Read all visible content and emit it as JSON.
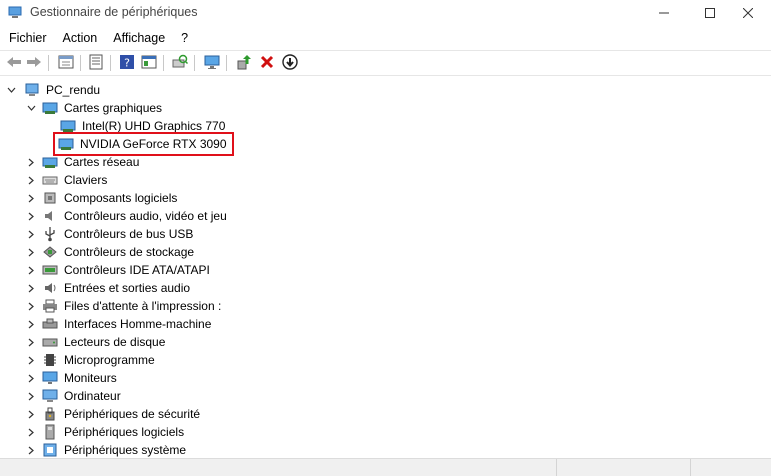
{
  "window": {
    "title": "Gestionnaire de périphériques",
    "icons": [
      "device-manager-icon",
      "minimize-icon",
      "maximize-icon",
      "close-icon"
    ]
  },
  "menu": [
    "Fichier",
    "Action",
    "Affichage",
    "?"
  ],
  "toolbar": {
    "icons": [
      "back-arrow-icon",
      "forward-arrow-icon",
      "properties-sheet-icon",
      "list-view-icon",
      "help-icon",
      "details-icon",
      "scan-hardware-icon",
      "monitor-icon",
      "update-driver-icon",
      "uninstall-icon",
      "disable-device-icon"
    ]
  },
  "tree": {
    "root": "PC_rendu",
    "expanded_category": "Cartes graphiques",
    "children": [
      {
        "label": "Intel(R) UHD Graphics 770",
        "highlighted": false
      },
      {
        "label": "NVIDIA GeForce RTX 3090",
        "highlighted": true
      }
    ],
    "categories": [
      "Cartes réseau",
      "Claviers",
      "Composants logiciels",
      "Contrôleurs audio, vidéo et jeu",
      "Contrôleurs de bus USB",
      "Contrôleurs de stockage",
      "Contrôleurs IDE ATA/ATAPI",
      "Entrées et sorties audio",
      "Files d'attente à l'impression :",
      "Interfaces Homme-machine",
      "Lecteurs de disque",
      "Microprogramme",
      "Moniteurs",
      "Ordinateur",
      "Périphériques de sécurité",
      "Périphériques logiciels",
      "Périphériques système"
    ]
  },
  "colors": {
    "highlight": "#e0101a",
    "accent": "#1e6fd0",
    "delete": "#d01010",
    "update": "#2e9a2e"
  }
}
